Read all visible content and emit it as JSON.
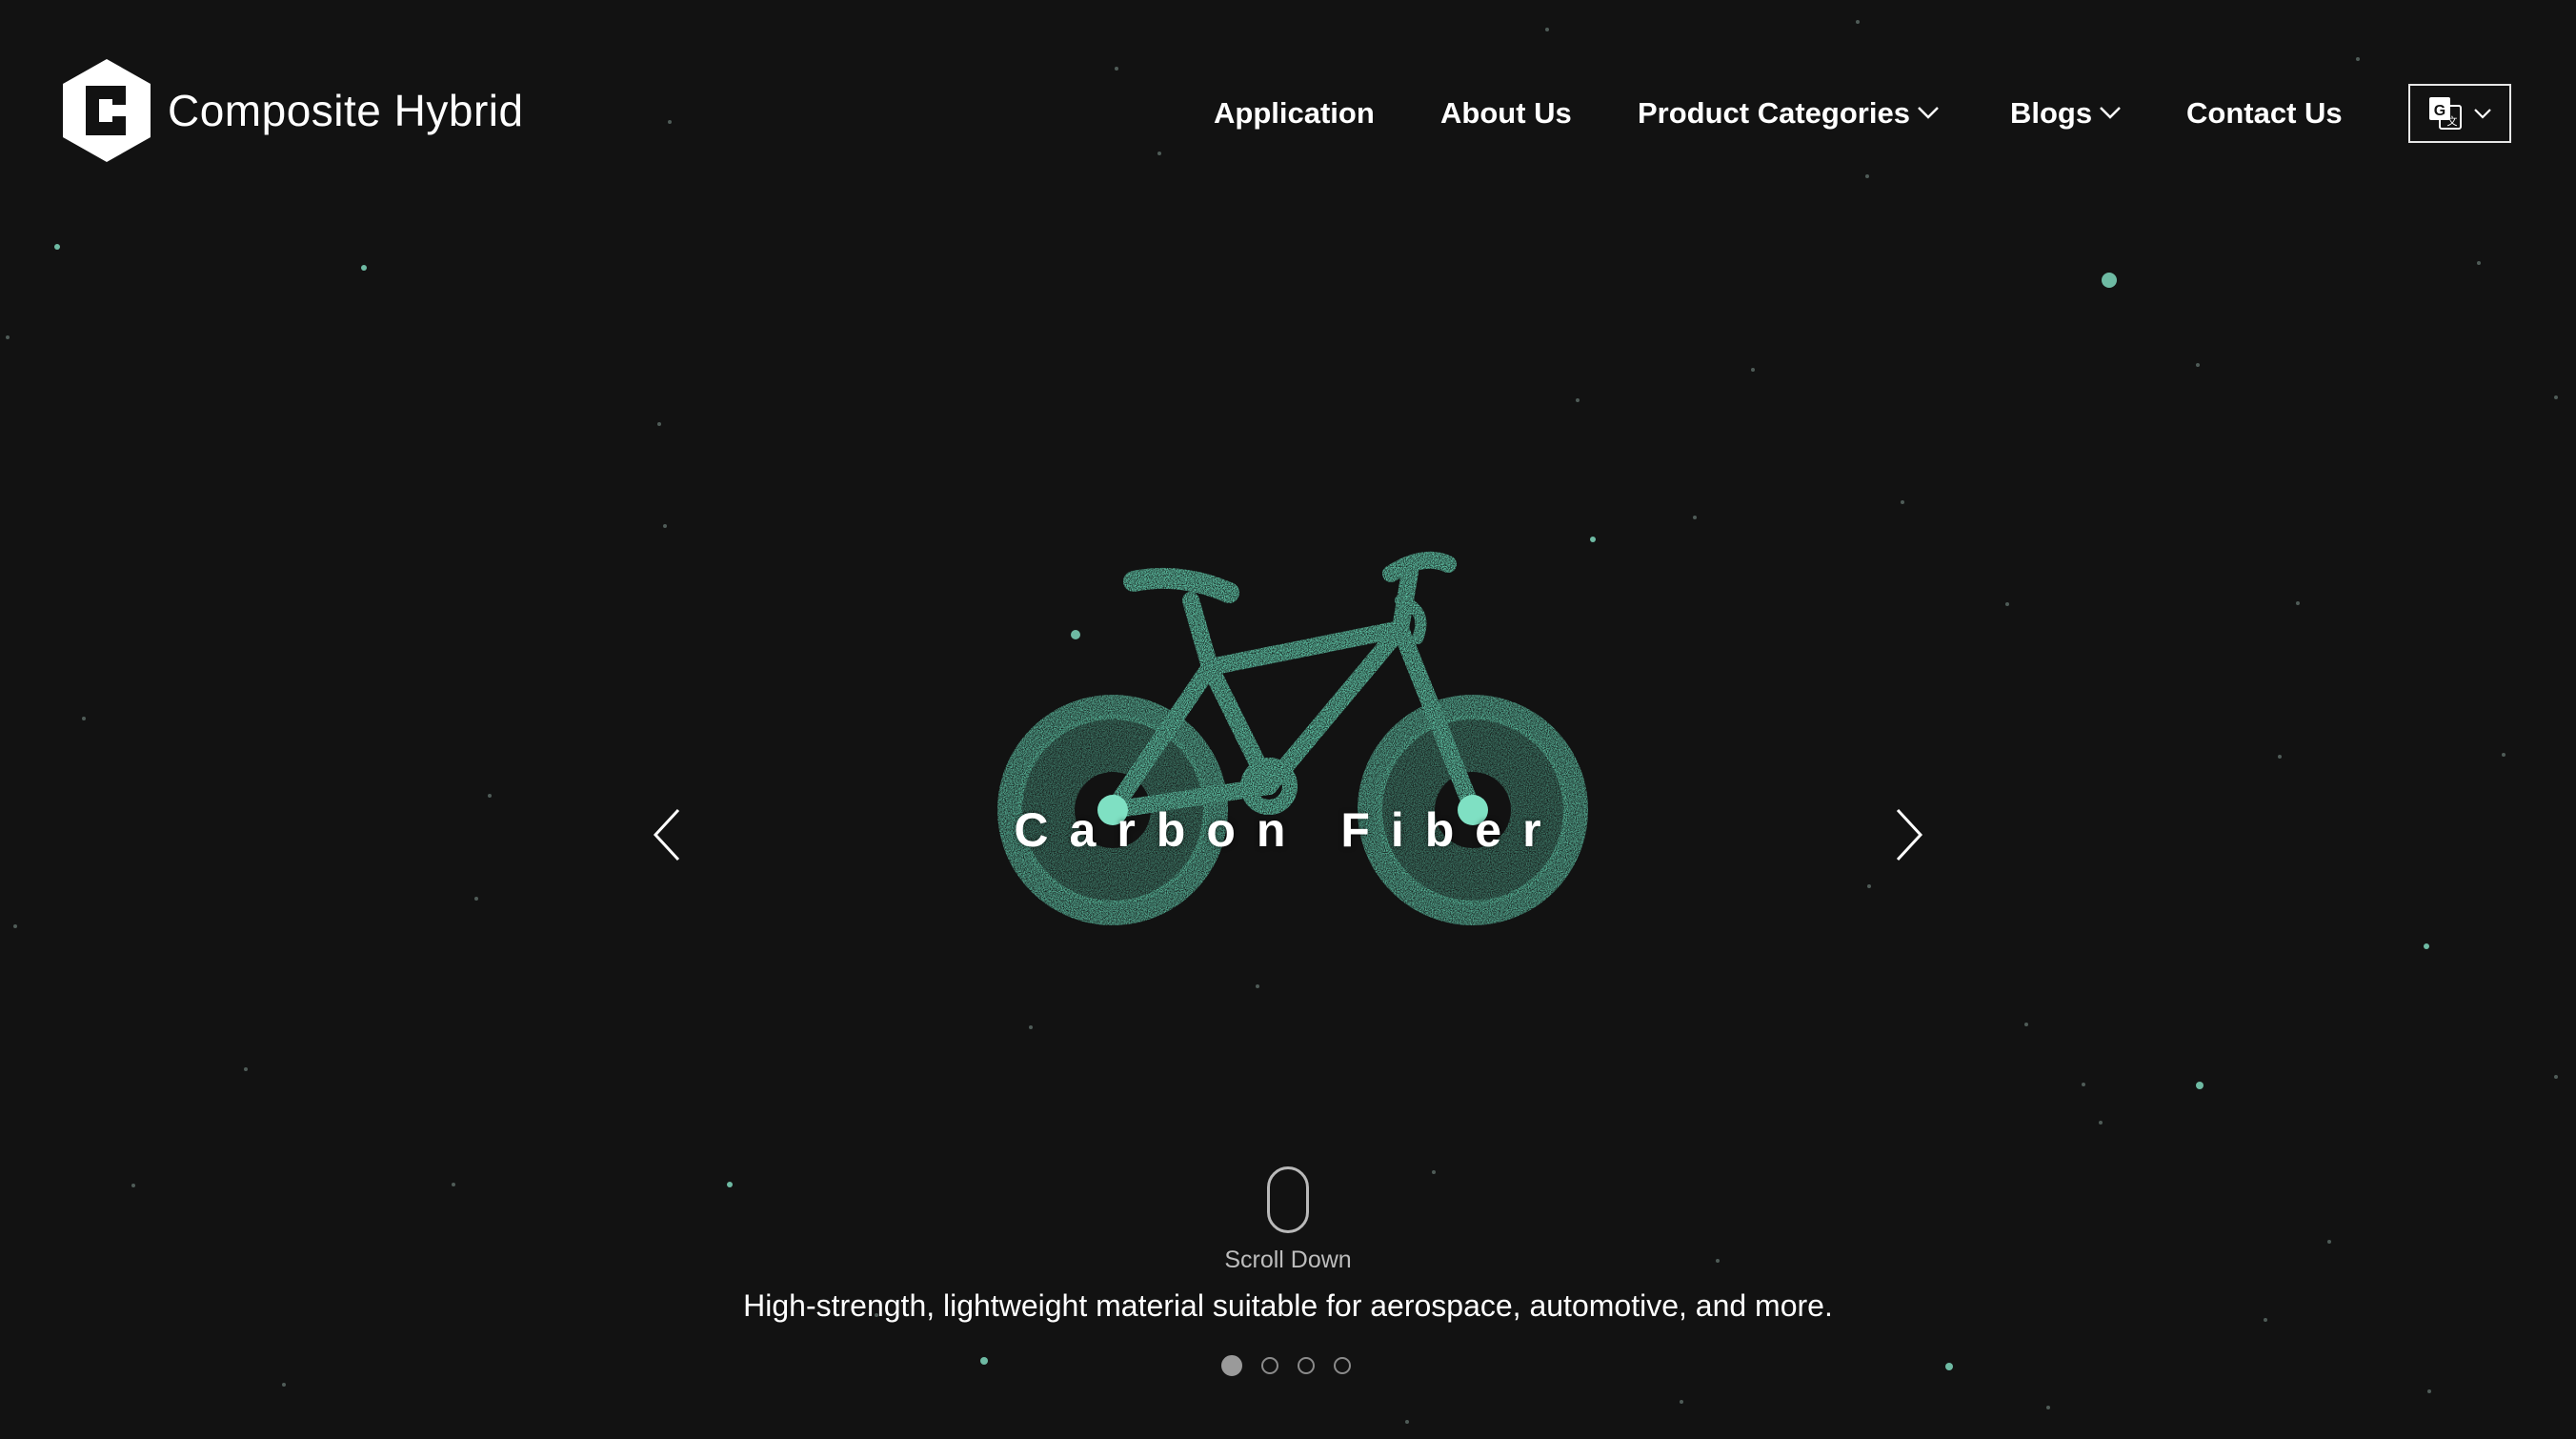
{
  "brand": {
    "name": "Composite Hybrid",
    "logo_icon": "hexagon-ch-logo-icon"
  },
  "nav": {
    "items": [
      {
        "label": "Application",
        "has_dropdown": false
      },
      {
        "label": "About Us",
        "has_dropdown": false
      },
      {
        "label": "Product Categories",
        "has_dropdown": true
      },
      {
        "label": "Blogs",
        "has_dropdown": true
      },
      {
        "label": "Contact Us",
        "has_dropdown": false
      }
    ],
    "language_icon": "google-translate-icon"
  },
  "hero": {
    "slide_title": "Carbon Fiber",
    "slide_description": "High-strength, lightweight material suitable for aerospace, automotive, and more.",
    "scroll_label": "Scroll Down",
    "slide_count": 4,
    "active_slide": 1,
    "particle_color": "#5fc6a8",
    "graphic": "bicycle-particle-illustration"
  },
  "colors": {
    "background": "#121212",
    "text": "#ffffff",
    "accent": "#5fc6a8"
  }
}
